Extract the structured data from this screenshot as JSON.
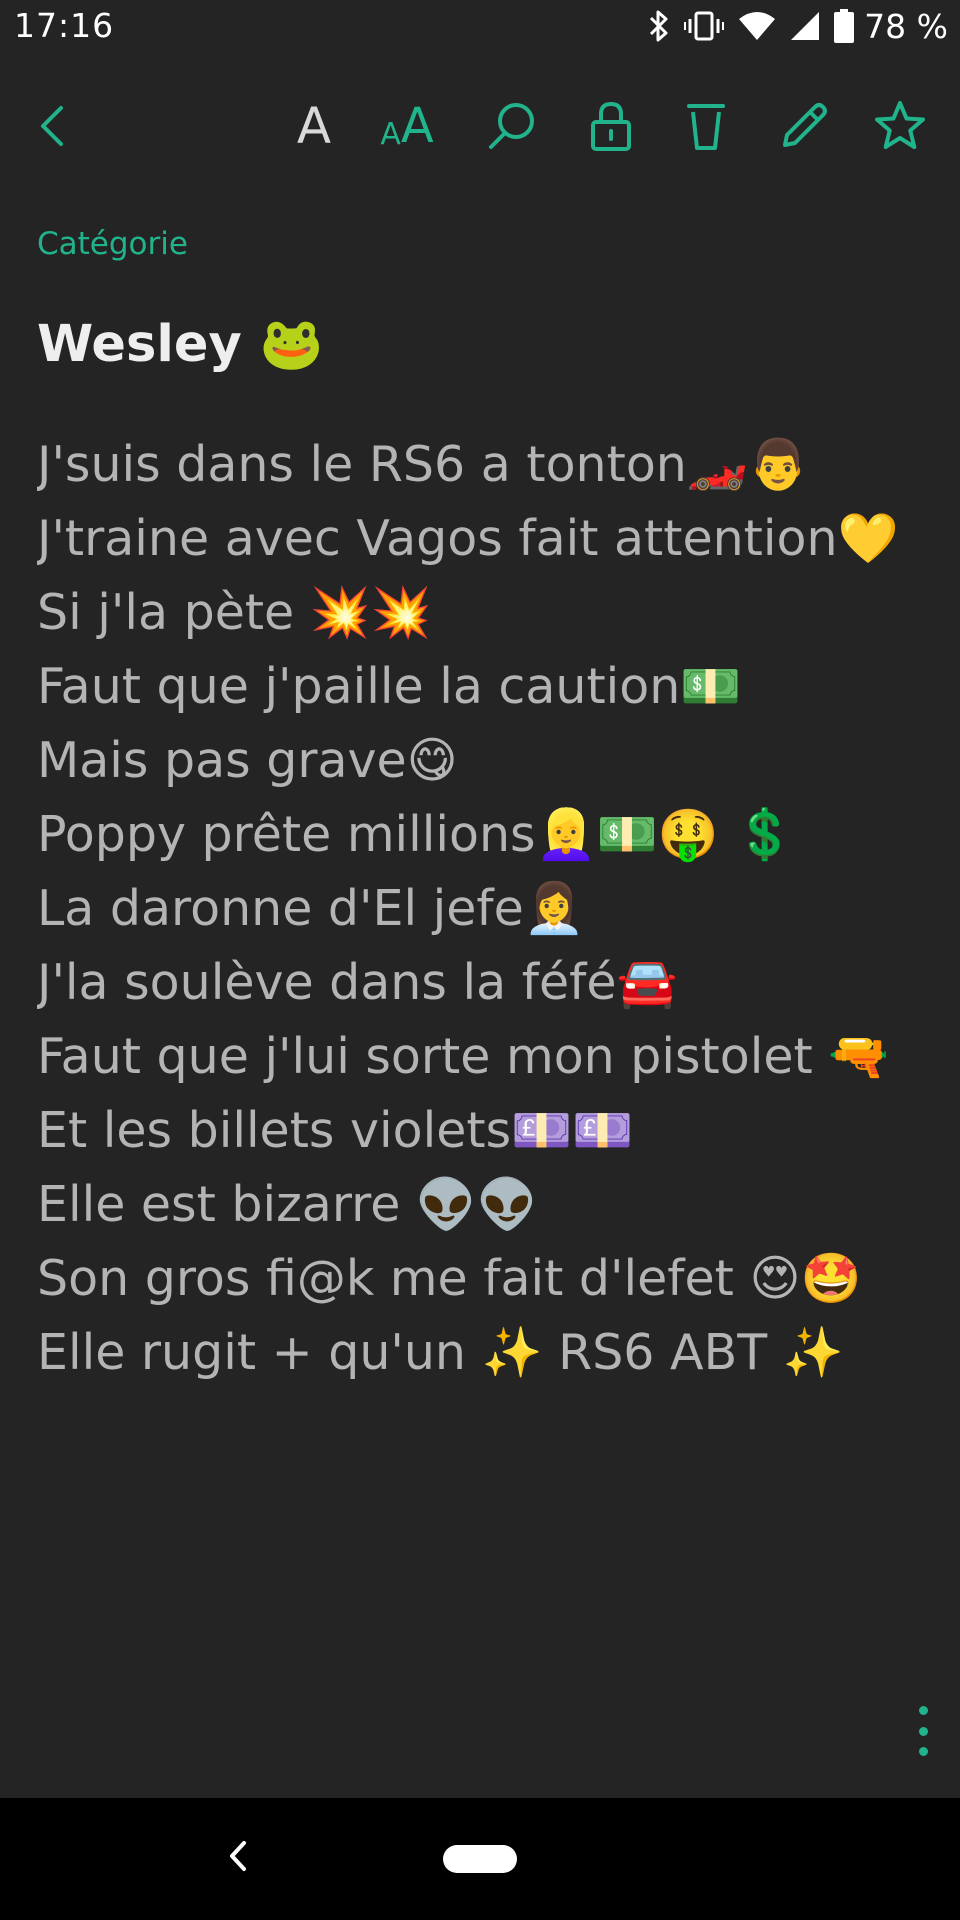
{
  "status_bar": {
    "time": "17:16",
    "battery": "78 %",
    "icons": [
      "bluetooth-icon",
      "vibrate-icon",
      "wifi-icon",
      "signal-icon",
      "battery-icon"
    ]
  },
  "toolbar": {
    "icons": [
      "back-icon",
      "font-size-icon",
      "font-size-large-icon",
      "search-icon",
      "lock-icon",
      "trash-icon",
      "edit-icon",
      "star-icon"
    ],
    "font_a": "A",
    "font_aa_small": "A",
    "font_aa_big": "A",
    "accent_color": "#21b48c"
  },
  "note": {
    "category": "Catégorie",
    "title": "Wesley 🐸",
    "lines": [
      "J'suis dans le RS6 a tonton🏎️👨",
      "J'traine avec Vagos fait attention💛",
      "Si j'la pète 💥💥",
      "Faut que j'paille la caution💵",
      "Mais pas grave😋",
      "Poppy prête millions👱‍♀️💵🤑 💲",
      "La daronne d'El jefe👩‍💼",
      "J'la soulève dans la féfé🚘",
      "Faut que j'lui sorte mon pistolet 🔫",
      "Et les billets violets💷💷",
      "Elle est bizarre 👽👽",
      "Son gros fi@k me fait d'lefet 😍🤩",
      "Elle rugit + qu'un ✨ RS6 ABT ✨"
    ]
  },
  "colors": {
    "background": "#242424",
    "text": "#b4b4b4",
    "title": "#eeeeee",
    "accent": "#21b48c"
  },
  "nav_bar": {
    "icons": [
      "nav-back-icon",
      "home-pill"
    ]
  }
}
